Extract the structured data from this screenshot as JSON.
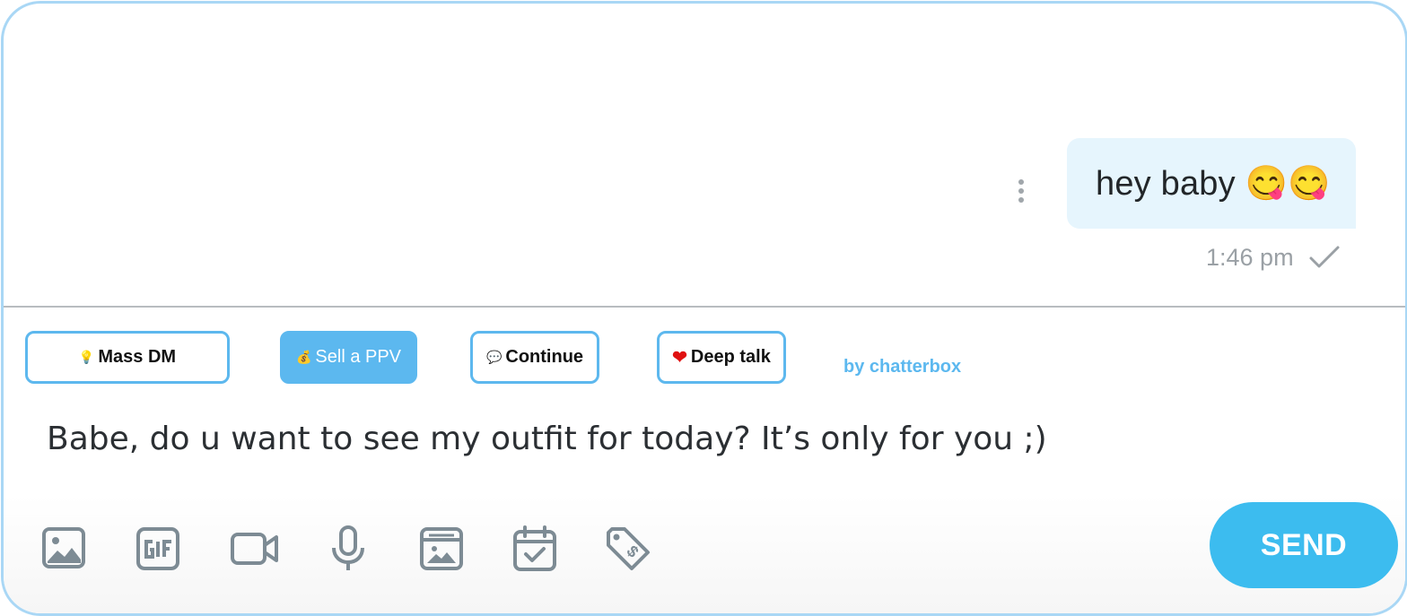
{
  "chat": {
    "message": {
      "text": "hey baby 😋😋",
      "time": "1:46 pm",
      "status_icon": "checkmark-icon",
      "menu_icon": "more-vertical-icon"
    }
  },
  "quick_actions": [
    {
      "icon": "lightbulb-icon",
      "emoji": "💡",
      "label": "Mass DM",
      "active": false
    },
    {
      "icon": "money-bag-icon",
      "emoji": "💰",
      "label": "Sell a PPV",
      "active": true
    },
    {
      "icon": "speech-bubble-icon",
      "emoji": "💬",
      "label": "Continue",
      "active": false
    },
    {
      "icon": "heart-icon",
      "emoji": "❤",
      "label": "Deep talk",
      "active": false
    }
  ],
  "brand_text": "by chatterbox",
  "composer": {
    "value": "Babe, do u want to see my outfit for today? It’s only for you ;)"
  },
  "toolbar": {
    "icons": [
      "image-icon",
      "gif-icon",
      "video-icon",
      "microphone-icon",
      "media-vault-icon",
      "schedule-calendar-icon",
      "price-tag-icon"
    ],
    "send_label": "SEND"
  },
  "colors": {
    "accent": "#3cbcef",
    "chip_border": "#5db8ee",
    "bubble_bg": "#e6f5fd",
    "frame_border": "#a9d7f5",
    "icon_gray": "#7d8b94"
  }
}
